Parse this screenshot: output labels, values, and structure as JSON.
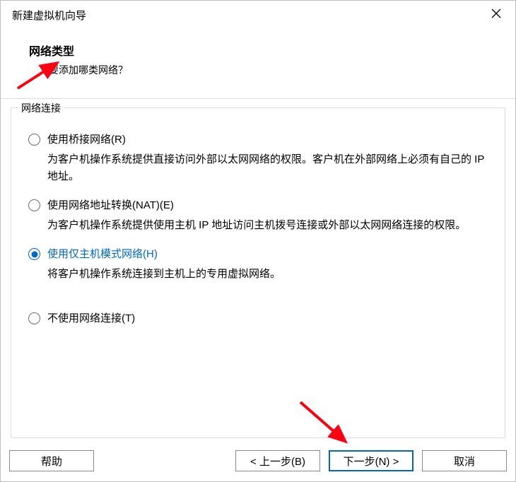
{
  "titlebar": {
    "title": "新建虚拟机向导"
  },
  "header": {
    "title": "网络类型",
    "subtitle": "要添加哪类网络？"
  },
  "fieldset": {
    "legend": "网络连接"
  },
  "options": [
    {
      "label": "使用桥接网络(R)",
      "desc": "为客户机操作系统提供直接访问外部以太网网络的权限。客户机在外部网络上必须有自己的 IP 地址。",
      "selected": false
    },
    {
      "label": "使用网络地址转换(NAT)(E)",
      "desc": "为客户机操作系统提供使用主机 IP 地址访问主机拨号连接或外部以太网网络连接的权限。",
      "selected": false
    },
    {
      "label": "使用仅主机模式网络(H)",
      "desc": "将客户机操作系统连接到主机上的专用虚拟网络。",
      "selected": true
    },
    {
      "label": "不使用网络连接(T)",
      "desc": "",
      "selected": false
    }
  ],
  "footer": {
    "help": "帮助",
    "back": "< 上一步(B)",
    "next": "下一步(N) >",
    "cancel": "取消"
  },
  "annotation_color": "#ff0012"
}
